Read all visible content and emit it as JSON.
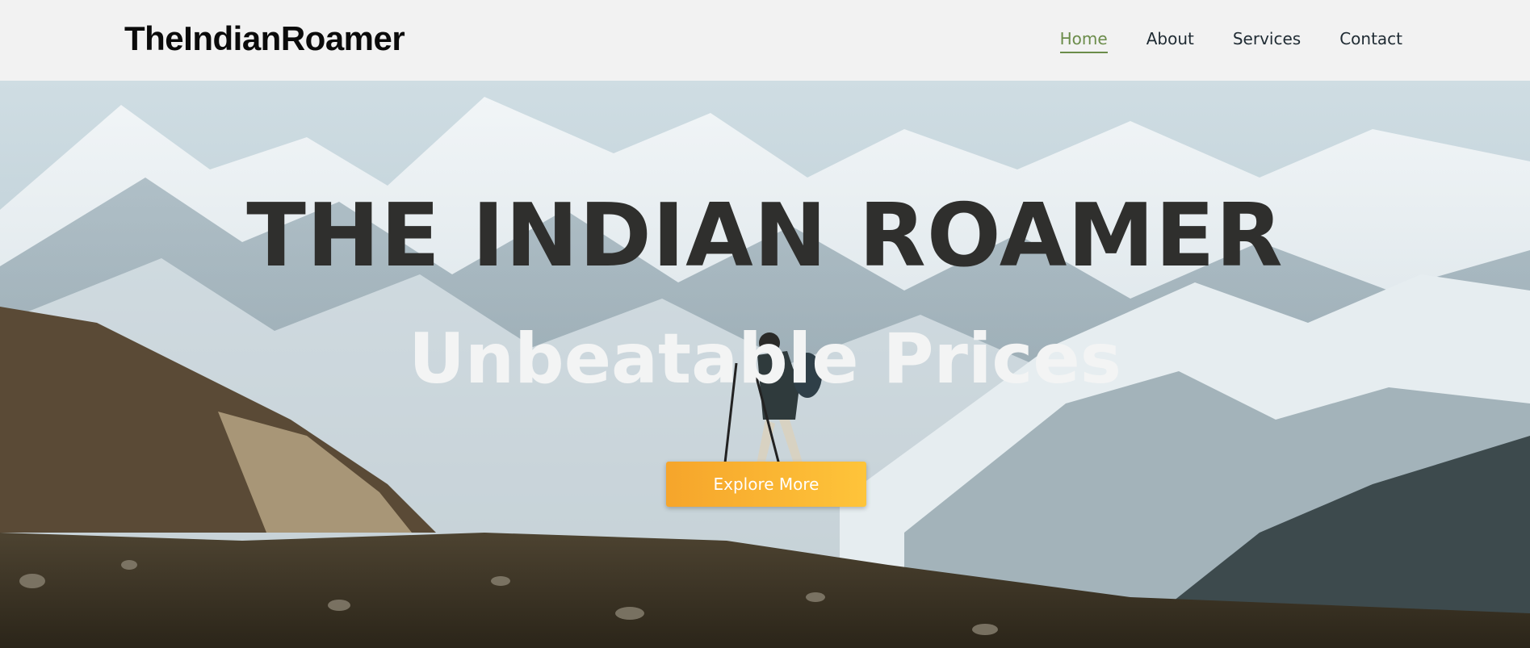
{
  "header": {
    "brand": "TheIndianRoamer",
    "nav": [
      {
        "label": "Home",
        "active": true
      },
      {
        "label": "About",
        "active": false
      },
      {
        "label": "Services",
        "active": false
      },
      {
        "label": "Contact",
        "active": false
      }
    ]
  },
  "hero": {
    "title": "THE INDIAN ROAMER",
    "subtitle": "Unbeatable Prices",
    "cta_label": "Explore More",
    "background": "mountain-trek-photo"
  },
  "colors": {
    "header_bg": "#f2f2f2",
    "nav_active": "#6b8c4a",
    "nav_text": "#1f2b33",
    "cta_start": "#f6a52b",
    "cta_end": "#fec43a",
    "title": "#2f2f2d",
    "subtitle": "#f3f4f4"
  }
}
